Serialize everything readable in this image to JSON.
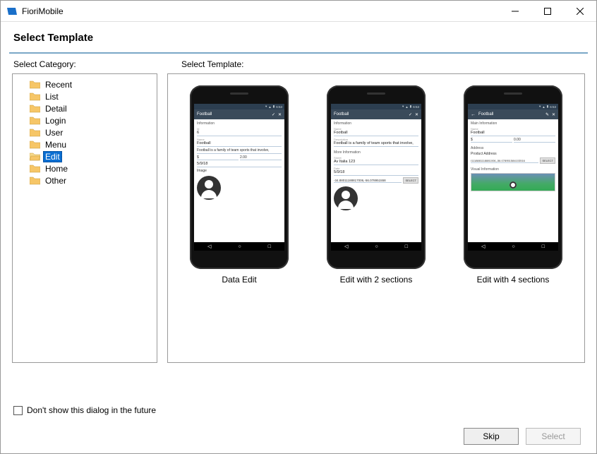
{
  "window": {
    "title": "FioriMobile"
  },
  "page": {
    "heading": "Select Template",
    "category_label": "Select Category:",
    "template_label": "Select Template:"
  },
  "tree": {
    "items": [
      {
        "label": "Recent",
        "selected": false
      },
      {
        "label": "List",
        "selected": false
      },
      {
        "label": "Detail",
        "selected": false
      },
      {
        "label": "Login",
        "selected": false
      },
      {
        "label": "User",
        "selected": false
      },
      {
        "label": "Menu",
        "selected": false
      },
      {
        "label": "Edit",
        "selected": true
      },
      {
        "label": "Home",
        "selected": false
      },
      {
        "label": "Other",
        "selected": false
      }
    ]
  },
  "templates": [
    {
      "label": "Data Edit"
    },
    {
      "label": "Edit with 2 sections"
    },
    {
      "label": "Edit with 4 sections"
    }
  ],
  "phone": {
    "time": "6:53",
    "title": "Football",
    "t1": {
      "section": "Information",
      "f1_label": "Id",
      "f1_val": "6",
      "f2_label": "Name",
      "f2_val": "Football",
      "desc": "Football is a family of team sports that involve,",
      "price_currency": "$",
      "price_val": "2.00",
      "date": "5/9/18",
      "image_label": "Image"
    },
    "t2": {
      "section1": "Information",
      "f1_label": "Name",
      "f1_val": "Football",
      "desc_label": "Description",
      "desc": "Football is a family of team sports that involve,",
      "section2": "More Information",
      "f_addr_label": "Street",
      "f_addr_val": "Av Italia 123",
      "f_date_label": "Date",
      "f_date_val": "5/9/18",
      "geo": "-34.88011188817006,-56.078951558",
      "select": "SELECT"
    },
    "t3": {
      "section1": "Main Information",
      "f1_label": "Name",
      "f1_val": "Football",
      "price_currency": "$",
      "price_val": "0.00",
      "section2": "Address",
      "addr_label": "Product Address",
      "addr_val": "I1118881118881006,-56.078951584103516",
      "select": "SELECT",
      "section3": "Visual Information"
    }
  },
  "footer": {
    "checkbox_label": "Don't show this dialog in the future",
    "skip": "Skip",
    "select": "Select"
  }
}
